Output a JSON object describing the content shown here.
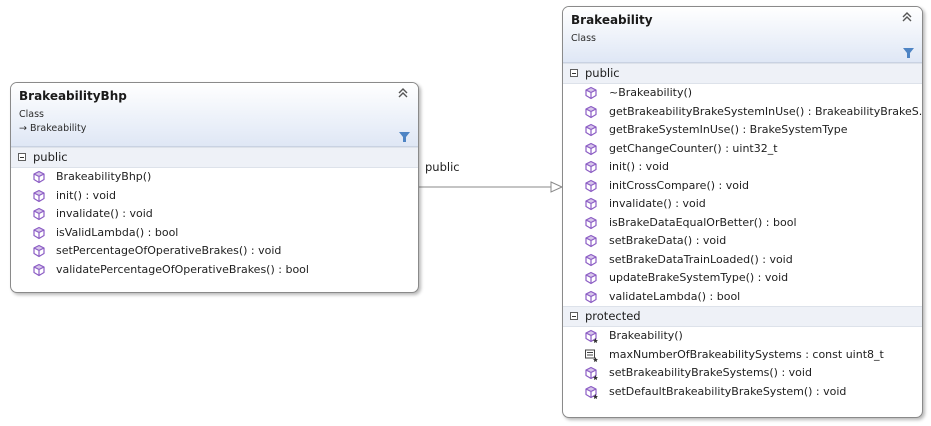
{
  "classes": [
    {
      "title": "BrakeabilityBhp",
      "stereotype": "Class",
      "base_prefix": "→",
      "base": "Brakeability",
      "sections": [
        {
          "label": "public",
          "members": [
            {
              "text": "BrakeabilityBhp()",
              "icon": "public-method-icon"
            },
            {
              "text": "init() : void",
              "icon": "public-method-icon"
            },
            {
              "text": "invalidate() : void",
              "icon": "public-method-icon"
            },
            {
              "text": "isValidLambda() : bool",
              "icon": "public-method-icon"
            },
            {
              "text": "setPercentageOfOperativeBrakes() : void",
              "icon": "public-method-icon"
            },
            {
              "text": "validatePercentageOfOperativeBrakes() : bool",
              "icon": "public-method-icon"
            }
          ]
        }
      ]
    },
    {
      "title": "Brakeability",
      "stereotype": "Class",
      "sections": [
        {
          "label": "public",
          "members": [
            {
              "text": "~Brakeability()",
              "icon": "public-method-icon"
            },
            {
              "text": "getBrakeabilityBrakeSystemInUse()  :  BrakeabilityBrakeS...",
              "icon": "public-method-icon"
            },
            {
              "text": "getBrakeSystemInUse() : BrakeSystemType",
              "icon": "public-method-icon"
            },
            {
              "text": "getChangeCounter() : uint32_t",
              "icon": "public-method-icon"
            },
            {
              "text": "init() : void",
              "icon": "public-method-icon"
            },
            {
              "text": "initCrossCompare() : void",
              "icon": "public-method-icon"
            },
            {
              "text": "invalidate() : void",
              "icon": "public-method-icon"
            },
            {
              "text": "isBrakeDataEqualOrBetter() : bool",
              "icon": "public-method-icon"
            },
            {
              "text": "setBrakeData() : void",
              "icon": "public-method-icon"
            },
            {
              "text": "setBrakeDataTrainLoaded() : void",
              "icon": "public-method-icon"
            },
            {
              "text": "updateBrakeSystemType() : void",
              "icon": "public-method-icon"
            },
            {
              "text": "validateLambda() : bool",
              "icon": "public-method-icon"
            }
          ]
        },
        {
          "label": "protected",
          "members": [
            {
              "text": "Brakeability()",
              "icon": "protected-method-icon"
            },
            {
              "text": "maxNumberOfBrakeabilitySystems : const uint8_t",
              "icon": "protected-field-icon"
            },
            {
              "text": "setBrakeabilityBrakeSystems() : void",
              "icon": "protected-method-icon"
            },
            {
              "text": "setDefaultBrakeabilityBrakeSystem() : void",
              "icon": "protected-method-icon"
            }
          ]
        }
      ]
    }
  ],
  "connector": {
    "label": "public",
    "type": "inheritance",
    "from": "BrakeabilityBhp",
    "to": "Brakeability"
  },
  "colors": {
    "method_icon": "#8b5cc4",
    "header_gradient_end": "#dfe7f5",
    "section_bg": "#eef1f7",
    "border": "#8a8a8a"
  }
}
